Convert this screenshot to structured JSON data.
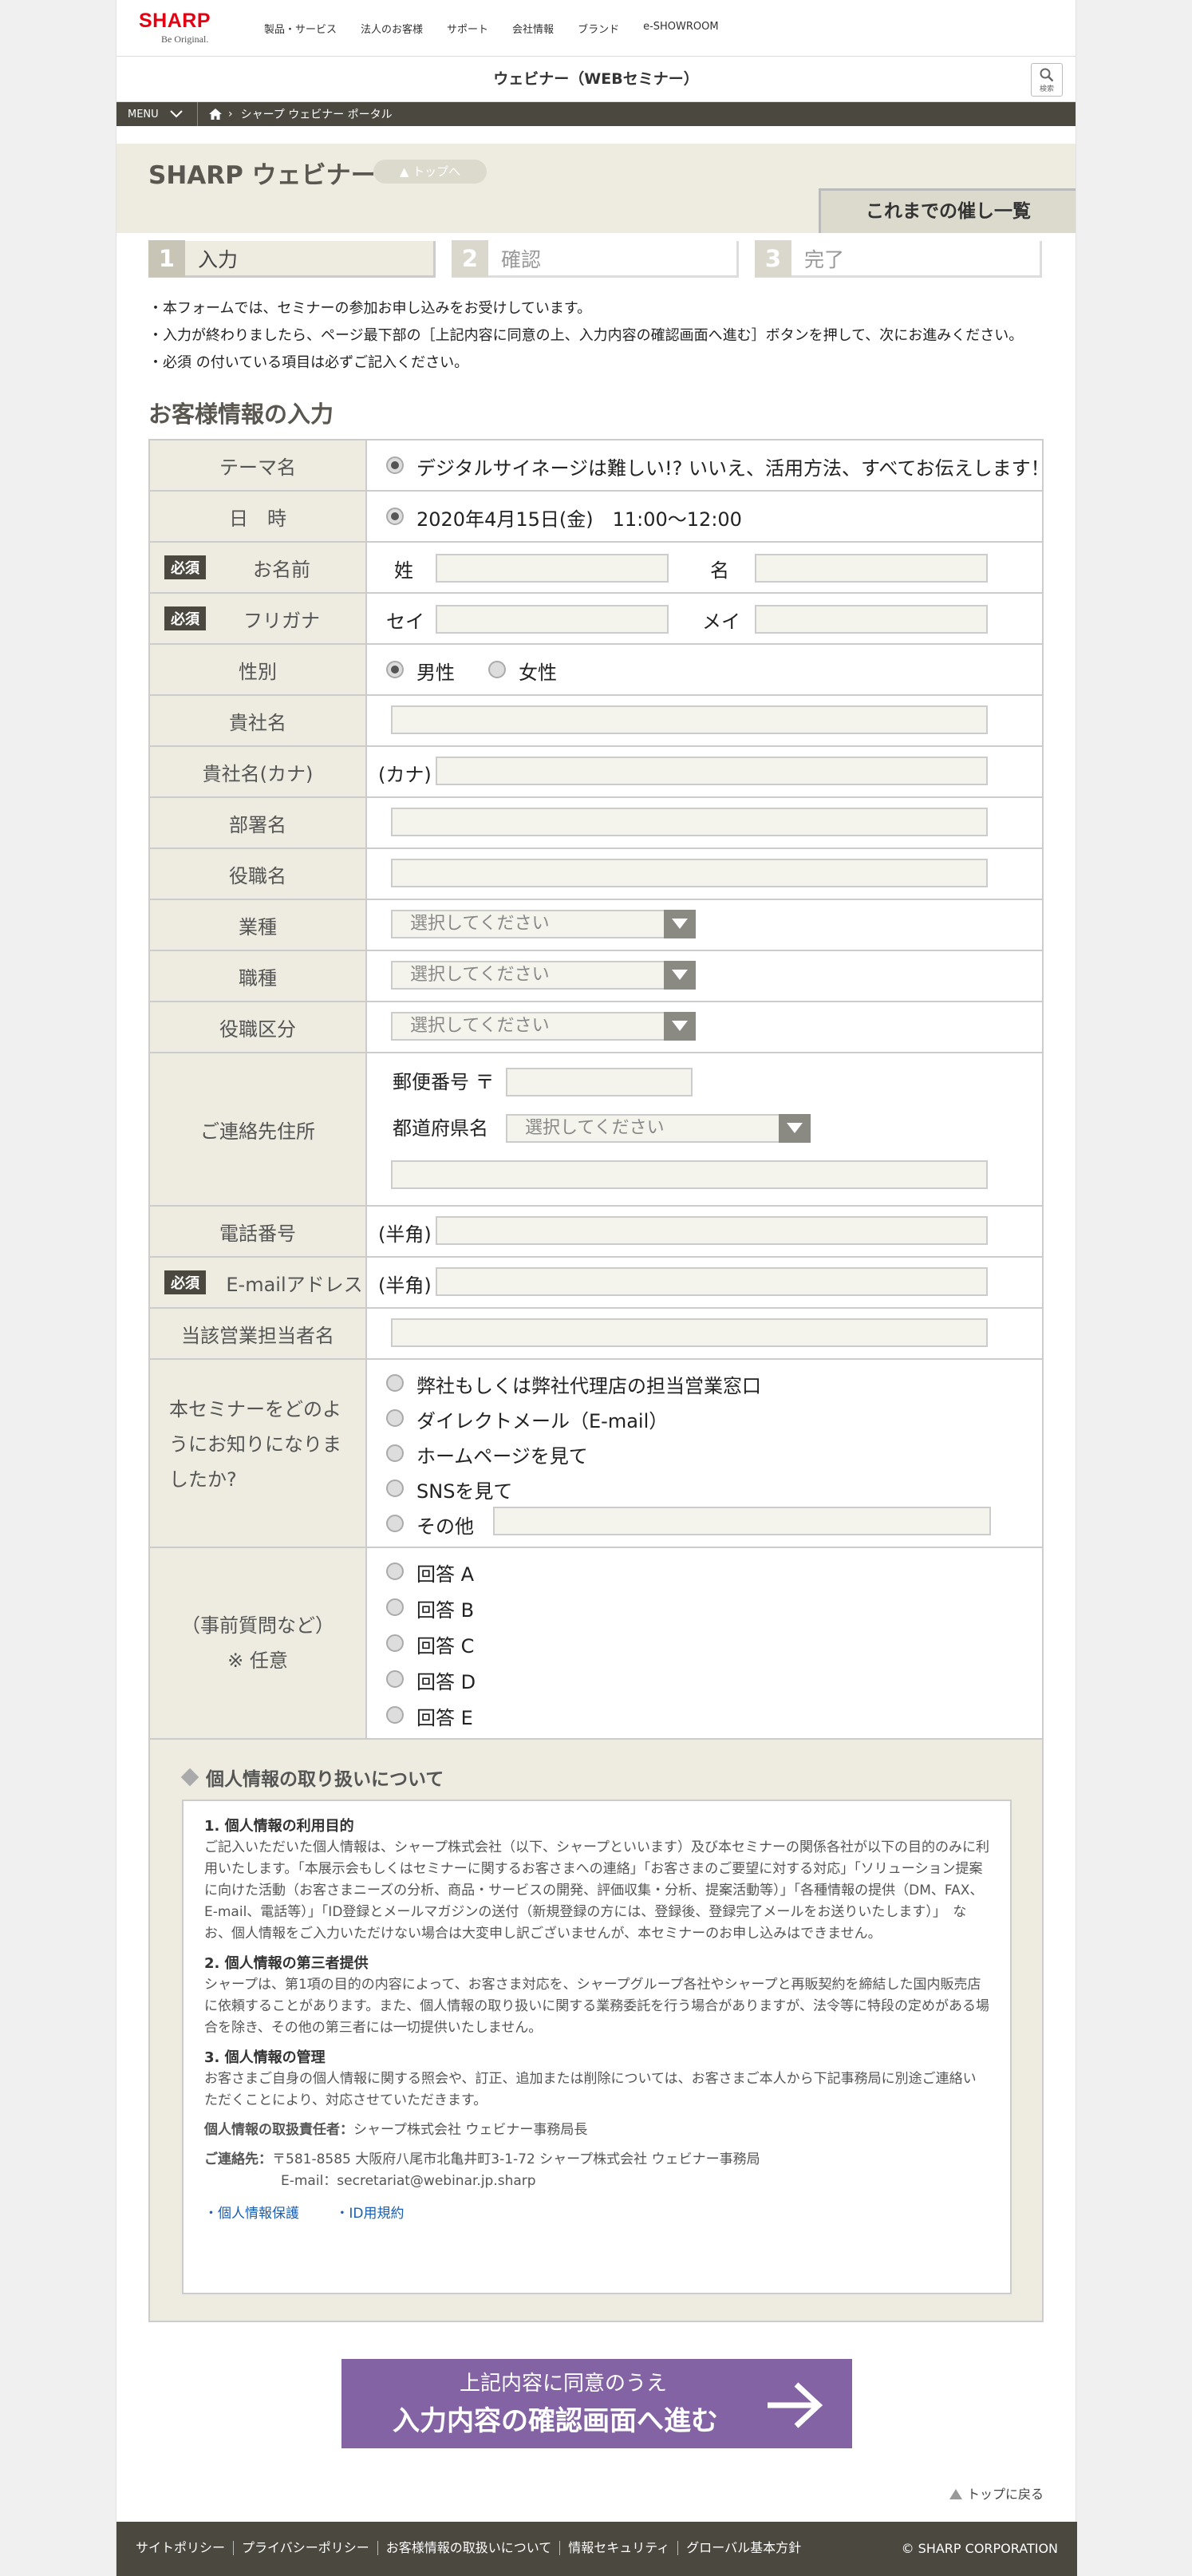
{
  "header": {
    "brand": "SHARP",
    "tagline": "Be Original.",
    "nav": [
      "製品・サービス",
      "法人のお客様",
      "サポート",
      "会社情報",
      "ブランド",
      "e-SHOWROOM"
    ],
    "title": "ウェビナー（WEBセミナー）",
    "search_label": "検索"
  },
  "breadcrumb": {
    "menu": "MENU",
    "current": "シャープ ウェビナー ポータル"
  },
  "portal": {
    "title": "SHARP ウェビナー",
    "top_button": "▲ トップへ",
    "past_events": "これまでの催し一覧"
  },
  "steps": [
    {
      "num": "1",
      "label": "入力"
    },
    {
      "num": "2",
      "label": "確認"
    },
    {
      "num": "3",
      "label": "完了"
    }
  ],
  "notes": [
    "・本フォームでは、セミナーの参加お申し込みをお受けしています。",
    "・入力が終わりましたら、ページ最下部の［上記内容に同意の上、入力内容の確認画面へ進む］ボタンを押して、次にお進みください。",
    "・必須 の付いている項目は必ずご記入ください。"
  ],
  "section_title": "お客様情報の入力",
  "form": {
    "required_badge": "必須",
    "theme_label": "テーマ名",
    "theme_value": "デジタルサイネージは難しい!?  いいえ、活用方法、すべてお伝えします！",
    "datetime_label": "日　時",
    "datetime_value": "2020年4月15日(金)　11:00〜12:00",
    "name_label": "お名前",
    "name_last": "姓",
    "name_first": "名",
    "kana_label": "フリガナ",
    "kana_last": "セイ",
    "kana_first": "メイ",
    "gender_label": "性別",
    "gender_male": "男性",
    "gender_female": "女性",
    "company_label": "貴社名",
    "company_kana_label": "貴社名(カナ)",
    "company_kana_prefix": "(カナ)",
    "dept_label": "部署名",
    "position_label": "役職名",
    "industry_label": "業種",
    "job_label": "職種",
    "rank_label": "役職区分",
    "select_placeholder": "選択してください",
    "address_label": "ご連絡先住所",
    "zip_label": "郵便番号 〒",
    "pref_label": "都道府県名",
    "phone_label": "電話番号",
    "halfwidth": "(半角)",
    "email_label": "E-mailアドレス",
    "rep_label": "当該営業担当者名",
    "source_label": "本セミナーをどのようにお知りになりましたか?",
    "source_options": [
      "弊社もしくは弊社代理店の担当営業窓口",
      "ダイレクトメール（E-mail）",
      "ホームページを見て",
      "SNSを見て",
      "その他"
    ],
    "question_label_1": "（事前質問など）",
    "question_label_2": "※ 任意",
    "question_options": [
      "回答 A",
      "回答 B",
      "回答 C",
      "回答 D",
      "回答 E"
    ]
  },
  "privacy": {
    "heading": "個人情報の取り扱いについて",
    "s1_title": "1. 個人情報の利用目的",
    "s1_body": "ご記入いただいた個人情報は、シャープ株式会社（以下、シャープといいます）及び本セミナーの関係各社が以下の目的のみに利用いたします。「本展示会もしくはセミナーに関するお客さまへの連絡」「お客さまのご要望に対する対応」「ソリューション提案に向けた活動（お客さまニーズの分析、商品・サービスの開発、評価収集・分析、提案活動等）」「各種情報の提供（DM、FAX、E-mail、電話等）」「ID登録とメールマガジンの送付（新規登録の方には、登録後、登録完了メールをお送りいたします）」　なお、個人情報をご入力いただけない場合は大変申し訳ございませんが、本セミナーのお申し込みはできません。",
    "s2_title": "2. 個人情報の第三者提供",
    "s2_body": "シャープは、第1項の目的の内容によって、お客さま対応を、シャープグループ各社やシャープと再販契約を締結した国内販売店に依頼することがあります。また、個人情報の取り扱いに関する業務委託を行う場合がありますが、法令等に特段の定めがある場合を除き、その他の第三者には一切提供いたしません。",
    "s3_title": "3. 個人情報の管理",
    "s3_body": "お客さまご自身の個人情報に関する照会や、訂正、追加または削除については、お客さまご本人から下記事務局に別途ご連絡いただくことにより、対応させていただきます。",
    "manager_label": "個人情報の取扱責任者：",
    "manager_value": "シャープ株式会社 ウェビナー事務局長",
    "contact_label": "ご連絡先：",
    "contact_value": "〒581-8585 大阪府八尾市北亀井町3-1-72  シャープ株式会社  ウェビナー事務局",
    "contact_email": "E-mail：secretariat@webinar.jp.sharp",
    "links": [
      "・個人情報保護",
      "・ID用規約"
    ]
  },
  "submit": {
    "line1": "上記内容に同意のうえ",
    "line2": "入力内容の確認画面へ進む"
  },
  "back_to_top": "トップに戻る",
  "footer": {
    "links": [
      "サイトポリシー",
      "プライバシーポリシー",
      "お客様情報の取扱いについて",
      "情報セキュリティ",
      "グローバル基本方針"
    ],
    "copyright": "© SHARP CORPORATION"
  }
}
